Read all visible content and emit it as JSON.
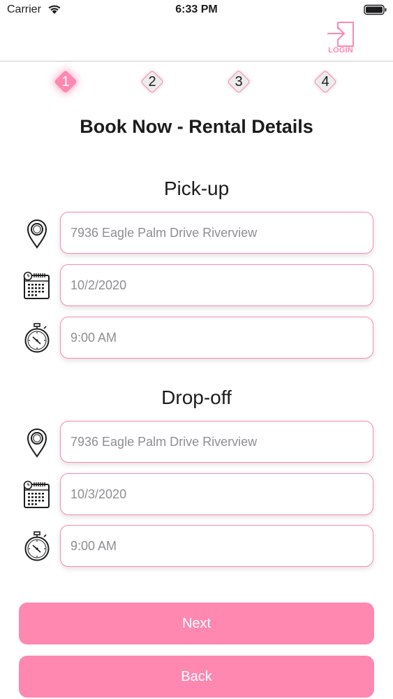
{
  "status_bar": {
    "carrier": "Carrier",
    "time": "6:33 PM",
    "icons": [
      "wifi-icon",
      "battery-icon"
    ]
  },
  "nav": {
    "login_label": "LOGIN",
    "login_icon": "login-icon"
  },
  "steps": [
    {
      "label": "1",
      "active": true
    },
    {
      "label": "2",
      "active": false
    },
    {
      "label": "3",
      "active": false
    },
    {
      "label": "4",
      "active": false
    }
  ],
  "page_title": "Book Now - Rental Details",
  "pickup": {
    "title": "Pick-up",
    "location": {
      "value": "",
      "placeholder": "7936 Eagle Palm Drive Riverview",
      "icon": "location-pin-icon"
    },
    "date": {
      "value": "",
      "placeholder": "10/2/2020",
      "icon": "calendar-icon"
    },
    "time": {
      "value": "",
      "placeholder": "9:00 AM",
      "icon": "stopwatch-icon"
    }
  },
  "dropoff": {
    "title": "Drop-off",
    "location": {
      "value": "",
      "placeholder": "7936 Eagle Palm Drive Riverview",
      "icon": "location-pin-icon"
    },
    "date": {
      "value": "",
      "placeholder": "10/3/2020",
      "icon": "calendar-icon"
    },
    "time": {
      "value": "",
      "placeholder": "9:00 AM",
      "icon": "stopwatch-icon"
    }
  },
  "buttons": {
    "next": "Next",
    "back": "Back"
  },
  "colors": {
    "accent": "#ff88b0",
    "text": "#1c1c1e",
    "placeholder": "#8e8e93",
    "step_inactive_bg": "#ececec"
  }
}
